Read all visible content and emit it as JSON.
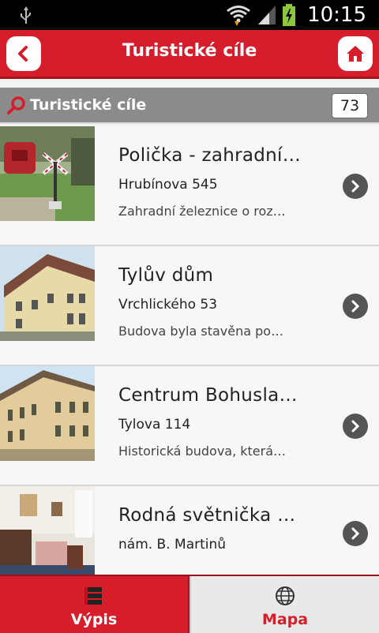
{
  "status_bar": {
    "time": "10:15"
  },
  "header": {
    "title": "Turistické cíle"
  },
  "search_bar": {
    "label": "Turistické cíle",
    "count": "73"
  },
  "items": [
    {
      "title": "Polička - zahradní…",
      "address": "Hrubínova 545",
      "description": "Zahradní železnice o roz…"
    },
    {
      "title": "Tylův dům",
      "address": "Vrchlického 53",
      "description": "Budova byla stavěna po…"
    },
    {
      "title": "Centrum Bohusla…",
      "address": "Tylova 114",
      "description": "Historická budova, která…"
    },
    {
      "title": "Rodná světnička …",
      "address": "nám. B. Martinů",
      "description": ""
    }
  ],
  "tabs": {
    "list_label": "Výpis",
    "map_label": "Mapa"
  },
  "colors": {
    "brand_red": "#d61d2c",
    "dark_red": "#a8121d",
    "gray_bar": "#8b8b8b"
  }
}
